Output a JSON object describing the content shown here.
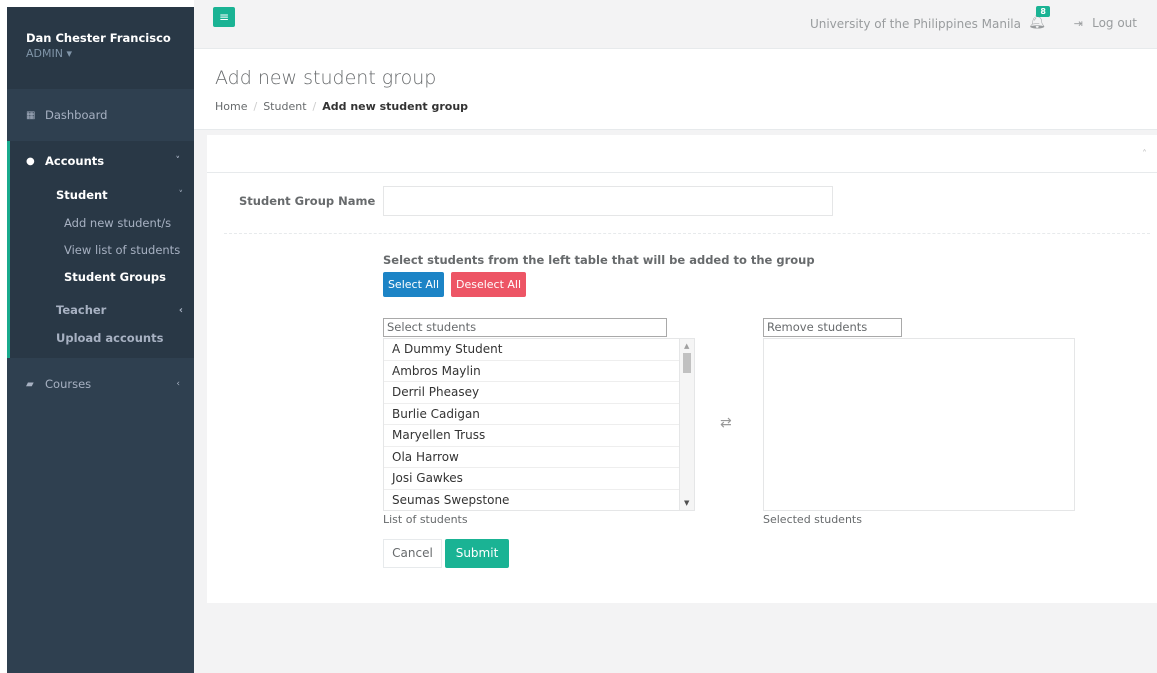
{
  "sidebar": {
    "user_name": "Dan Chester Francisco",
    "role": "ADMIN",
    "role_caret": "▾",
    "dashboard_label": "Dashboard",
    "accounts_label": "Accounts",
    "student_label": "Student",
    "student_items": [
      "Add new student/s",
      "View list of students",
      "Student Groups"
    ],
    "teacher_label": "Teacher",
    "upload_label": "Upload accounts",
    "courses_label": "Courses"
  },
  "topbar": {
    "menu_glyph": "≡",
    "org_name": "University of the Philippines Manila",
    "notification_count": "8",
    "logout_label": "Log out"
  },
  "header": {
    "title": "Add new student group",
    "breadcrumb": [
      "Home",
      "Student",
      "Add new student group"
    ]
  },
  "form": {
    "group_name_label": "Student Group Name",
    "group_name_value": "",
    "instruction": "Select students from the left table that will be added to the group",
    "select_all_label": "Select All",
    "deselect_all_label": "Deselect All",
    "left_filter_placeholder": "Select students",
    "right_filter_placeholder": "Remove students",
    "students": [
      "A Dummy Student",
      "Ambros Maylin",
      "Derril Pheasey",
      "Burlie Cadigan",
      "Maryellen Truss",
      "Ola Harrow",
      "Josi Gawkes",
      "Seumas Swepstone"
    ],
    "left_caption": "List of students",
    "right_caption": "Selected students",
    "cancel_label": "Cancel",
    "submit_label": "Submit"
  },
  "colors": {
    "sidebar_bg": "#2f4050",
    "accent_green": "#1ab394",
    "primary_blue": "#1c84c6",
    "danger_red": "#ed5565"
  }
}
